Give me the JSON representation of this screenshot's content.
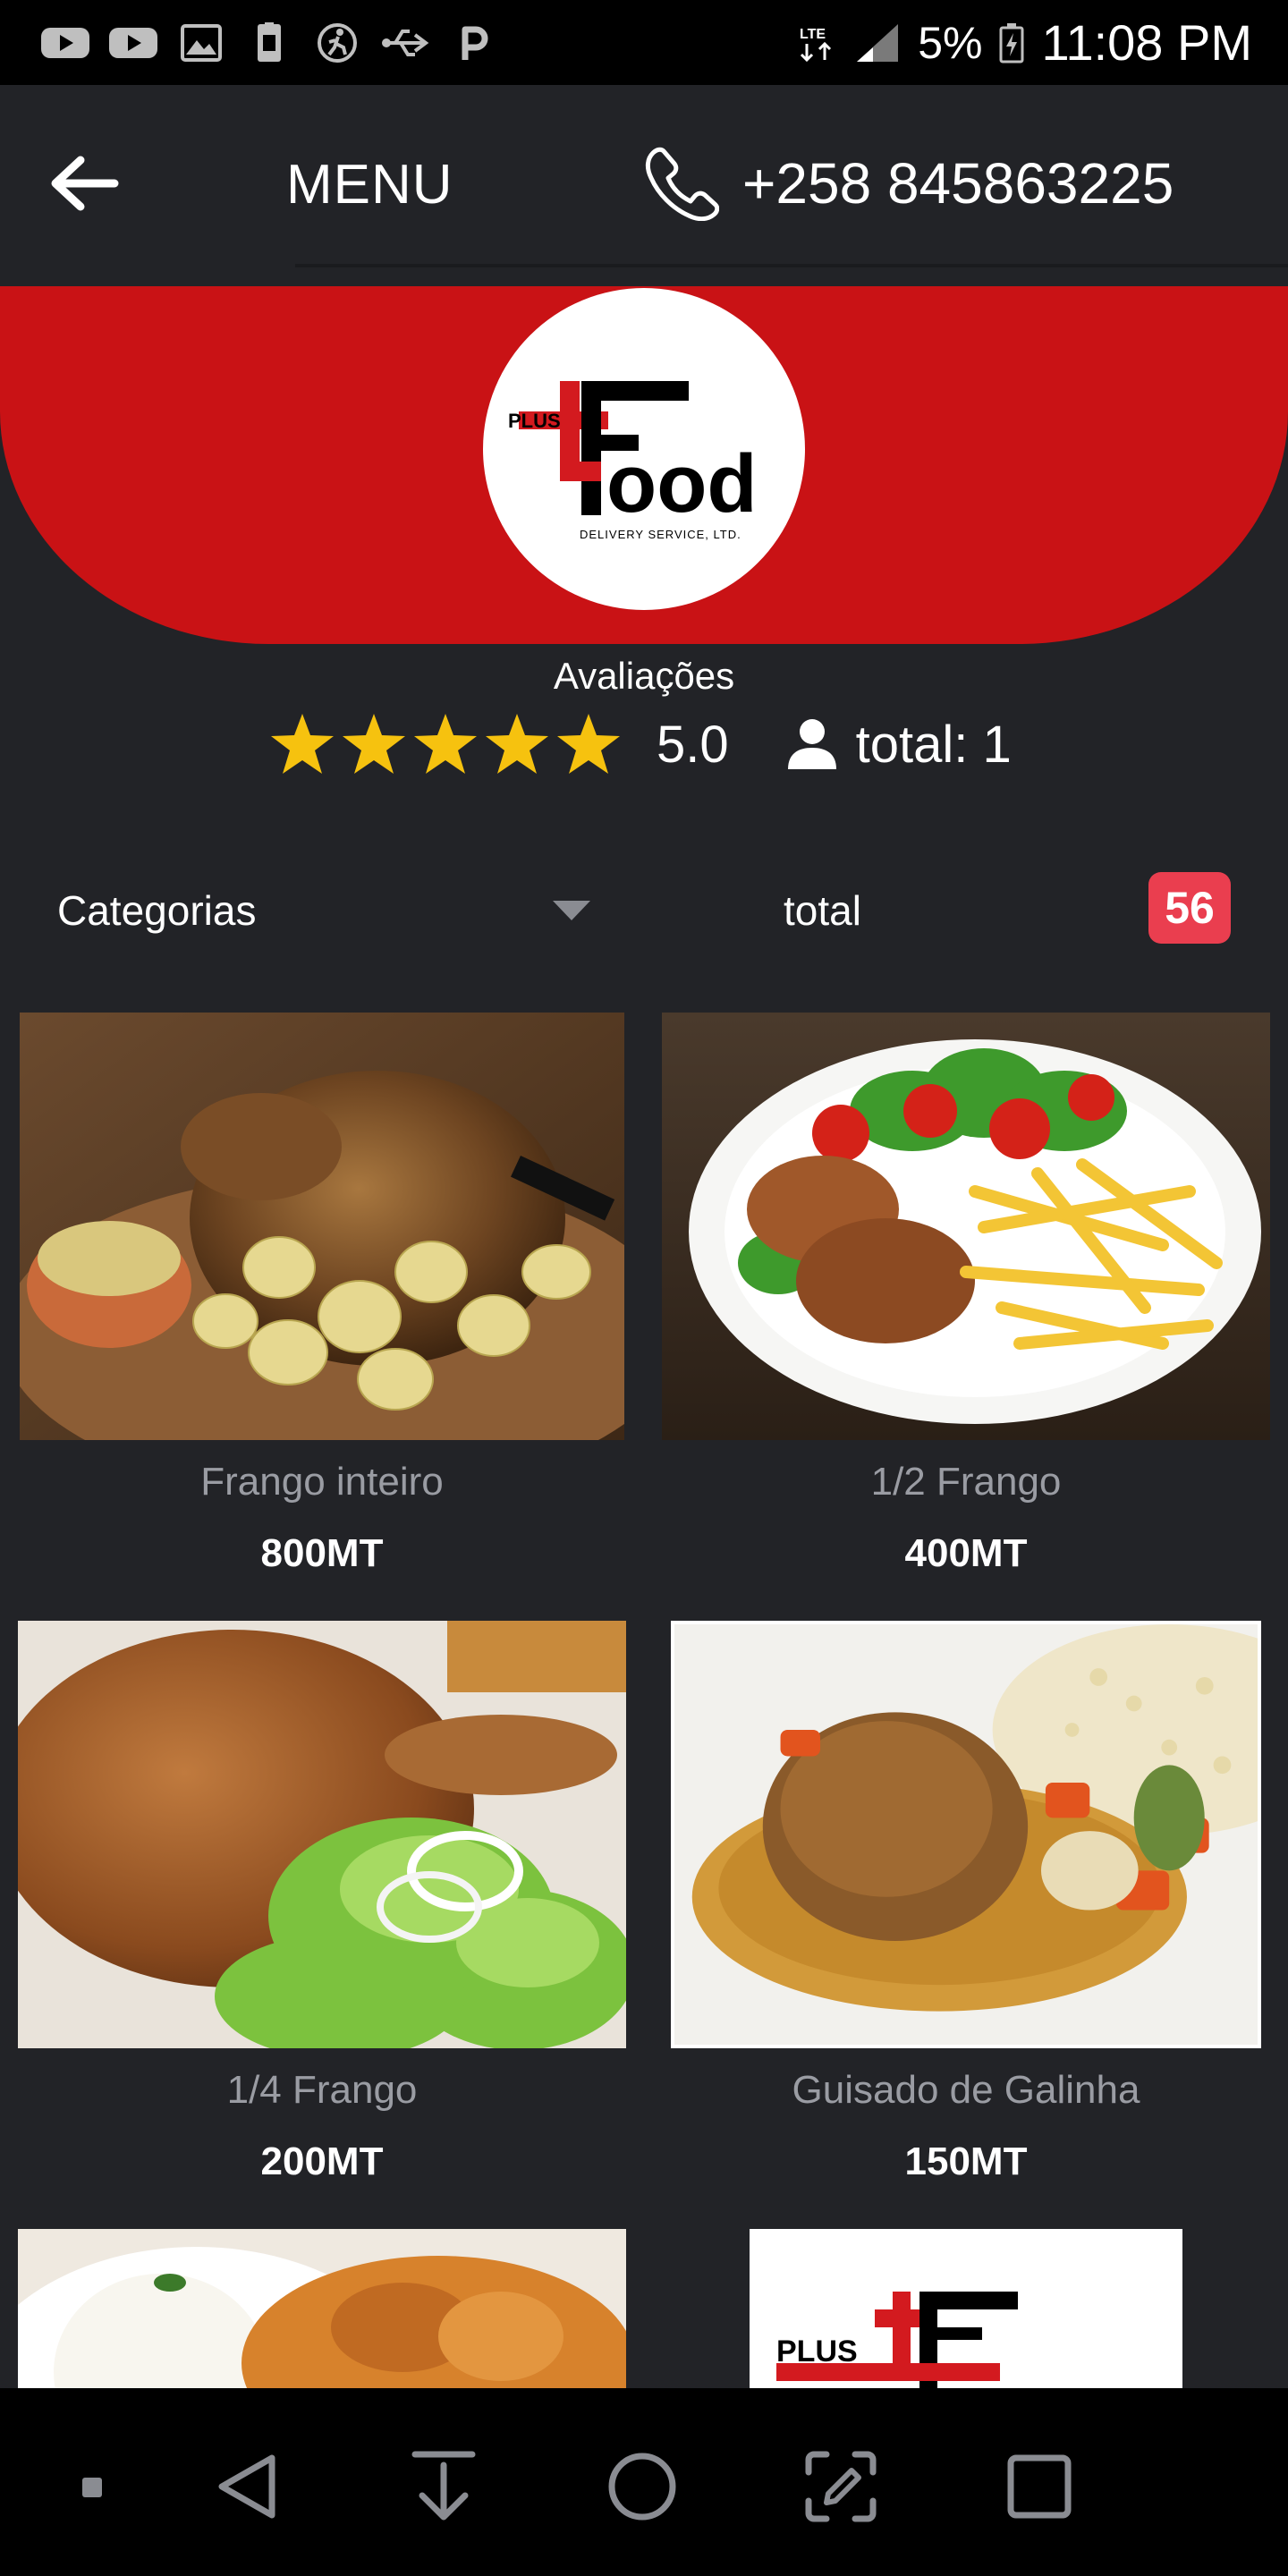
{
  "status_bar": {
    "battery": "5%",
    "time": "11:08 PM",
    "network": "LTE",
    "left_icons": [
      "youtube-icon",
      "youtube-icon",
      "gallery-icon",
      "sim-icon",
      "fitness-icon",
      "usb-icon",
      "parking-icon"
    ]
  },
  "app_bar": {
    "title": "MENU",
    "phone": "+258 845863225"
  },
  "brand": {
    "logo_top": "PLUS",
    "logo_word": "ood",
    "logo_sub": "DELIVERY SERVICE, LTD.",
    "primary_color": "#c91215"
  },
  "rating": {
    "label": "Avaliações",
    "value": "5.0",
    "stars": 5,
    "total_text": "total: 1"
  },
  "filters": {
    "category_label": "Categorias",
    "total_label": "total",
    "count": "56"
  },
  "products": [
    {
      "name": "Frango inteiro",
      "price": "800MT"
    },
    {
      "name": "1/2 Frango",
      "price": "400MT"
    },
    {
      "name": "1/4 Frango",
      "price": "200MT"
    },
    {
      "name": "Guisado de Galinha",
      "price": "150MT"
    }
  ],
  "partial_logo": {
    "text": "PLUS"
  },
  "nav": [
    "dot",
    "back",
    "download",
    "home",
    "screenshot",
    "recents"
  ]
}
